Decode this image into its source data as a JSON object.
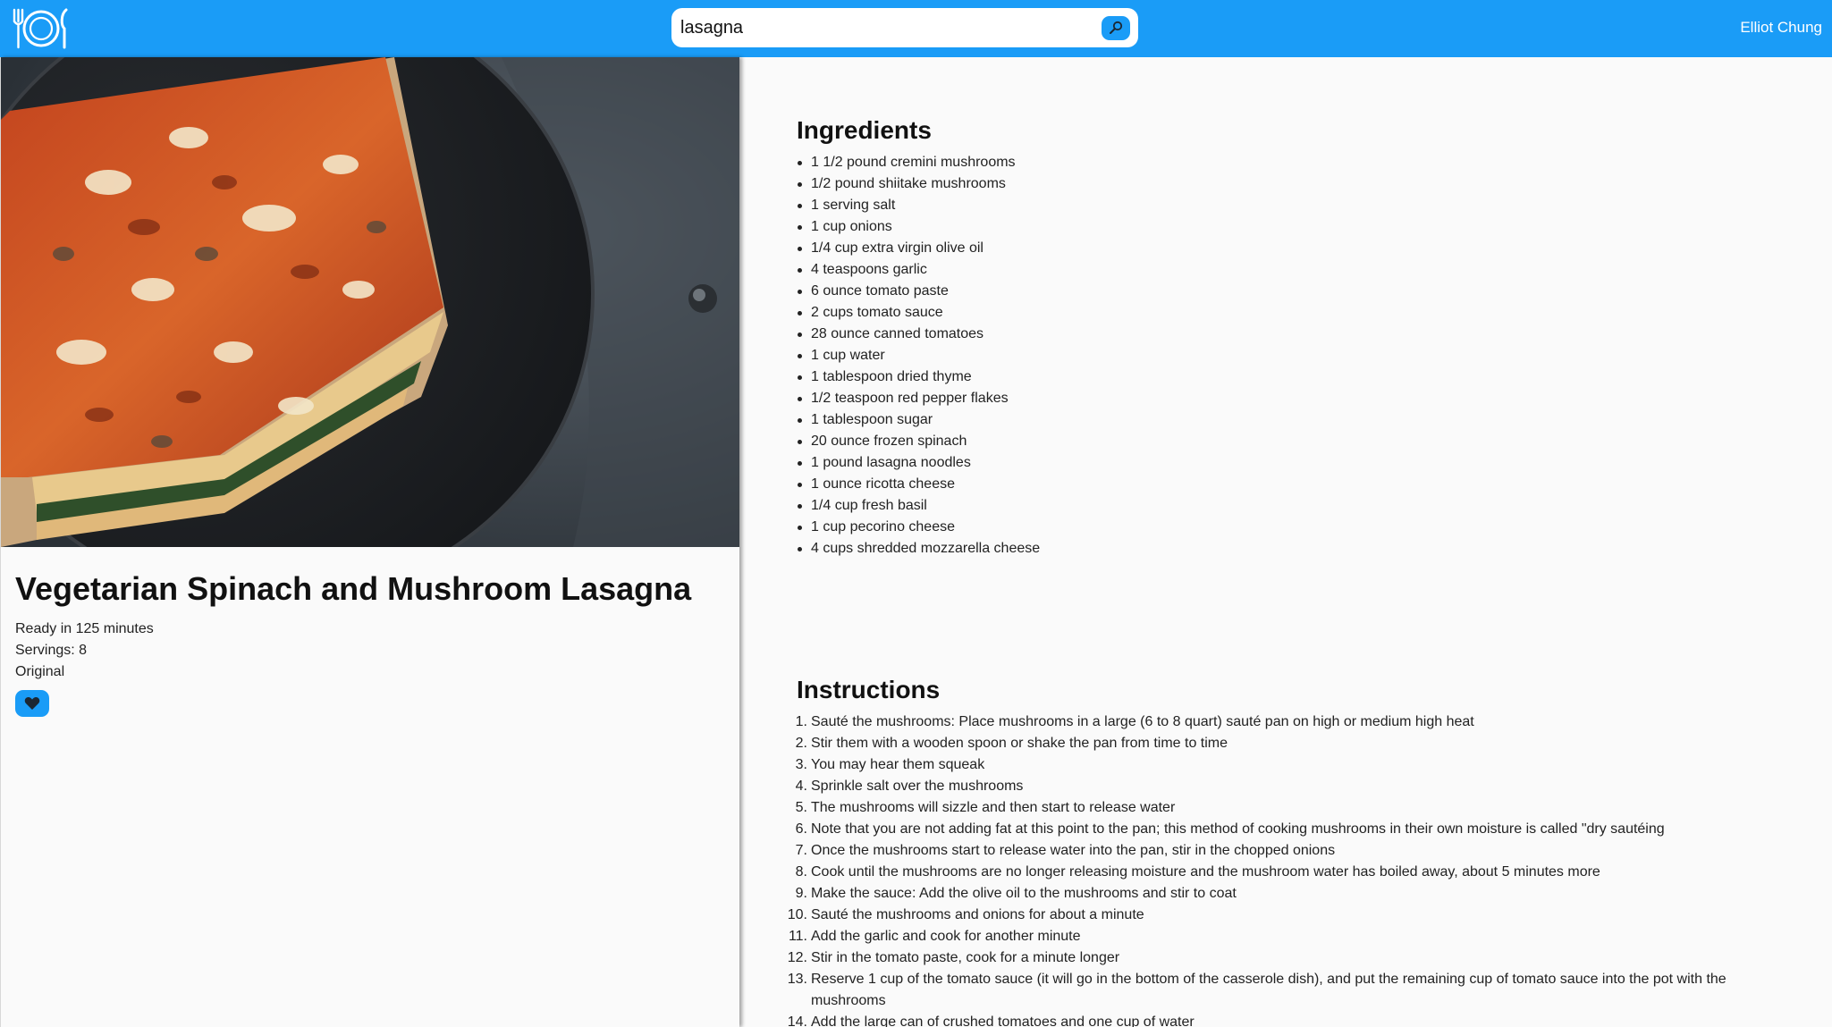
{
  "header": {
    "logo_icon": "plate-fork-knife-icon",
    "search_value": "lasagna",
    "search_button_icon": "search-icon",
    "user_name": "Elliot Chung",
    "brand_color": "#1a9cf7"
  },
  "recipe": {
    "title": "Vegetarian Spinach and Mushroom Lasagna",
    "ready_in": "Ready in 125 minutes",
    "servings": "Servings: 8",
    "source": "Original",
    "favorite_icon": "heart-icon"
  },
  "ingredients": {
    "heading": "Ingredients",
    "items": [
      "1 1/2 pound cremini mushrooms",
      "1/2 pound shiitake mushrooms",
      "1 serving salt",
      "1 cup onions",
      "1/4 cup extra virgin olive oil",
      "4 teaspoons garlic",
      "6 ounce tomato paste",
      "2 cups tomato sauce",
      "28 ounce canned tomatoes",
      "1 cup water",
      "1 tablespoon dried thyme",
      "1/2 teaspoon red pepper flakes",
      "1 tablespoon sugar",
      "20 ounce frozen spinach",
      "1 pound lasagna noodles",
      "1 ounce ricotta cheese",
      "1/4 cup fresh basil",
      "1 cup pecorino cheese",
      "4 cups shredded mozzarella cheese"
    ]
  },
  "instructions": {
    "heading": "Instructions",
    "steps": [
      {
        "num": "1.",
        "text": "Sauté the mushrooms: Place mushrooms in a large (6 to 8 quart) sauté pan on high or medium high heat"
      },
      {
        "num": "2.",
        "text": "Stir them with a wooden spoon or shake the pan from time to time"
      },
      {
        "num": "3.",
        "text": "You may hear them squeak"
      },
      {
        "num": "4.",
        "text": "Sprinkle salt over the mushrooms"
      },
      {
        "num": "5.",
        "text": "The mushrooms will sizzle and then start to release water"
      },
      {
        "num": "6.",
        "text": "Note that you are not adding fat at this point to the pan; this method of cooking mushrooms in their own moisture is called \"dry sautéing"
      },
      {
        "num": "7.",
        "text": "Once the mushrooms start to release water into the pan, stir in the chopped onions"
      },
      {
        "num": "8.",
        "text": "Cook until the mushrooms are no longer releasing moisture and the mushroom water has boiled away, about 5 minutes more"
      },
      {
        "num": "9.",
        "text": "Make the sauce: Add the olive oil to the mushrooms and stir to coat"
      },
      {
        "num": "10.",
        "text": "Sauté the mushrooms and onions for about a minute"
      },
      {
        "num": "11.",
        "text": "Add the garlic and cook for another minute"
      },
      {
        "num": "12.",
        "text": "Stir in the tomato paste, cook for a minute longer"
      },
      {
        "num": "13.",
        "text": "Reserve 1 cup of the tomato sauce (it will go in the bottom of the casserole dish), and put the remaining cup of tomato sauce into the pot with the mushrooms"
      },
      {
        "num": "14.",
        "text": "Add the large can of crushed tomatoes and one cup of water"
      }
    ]
  }
}
